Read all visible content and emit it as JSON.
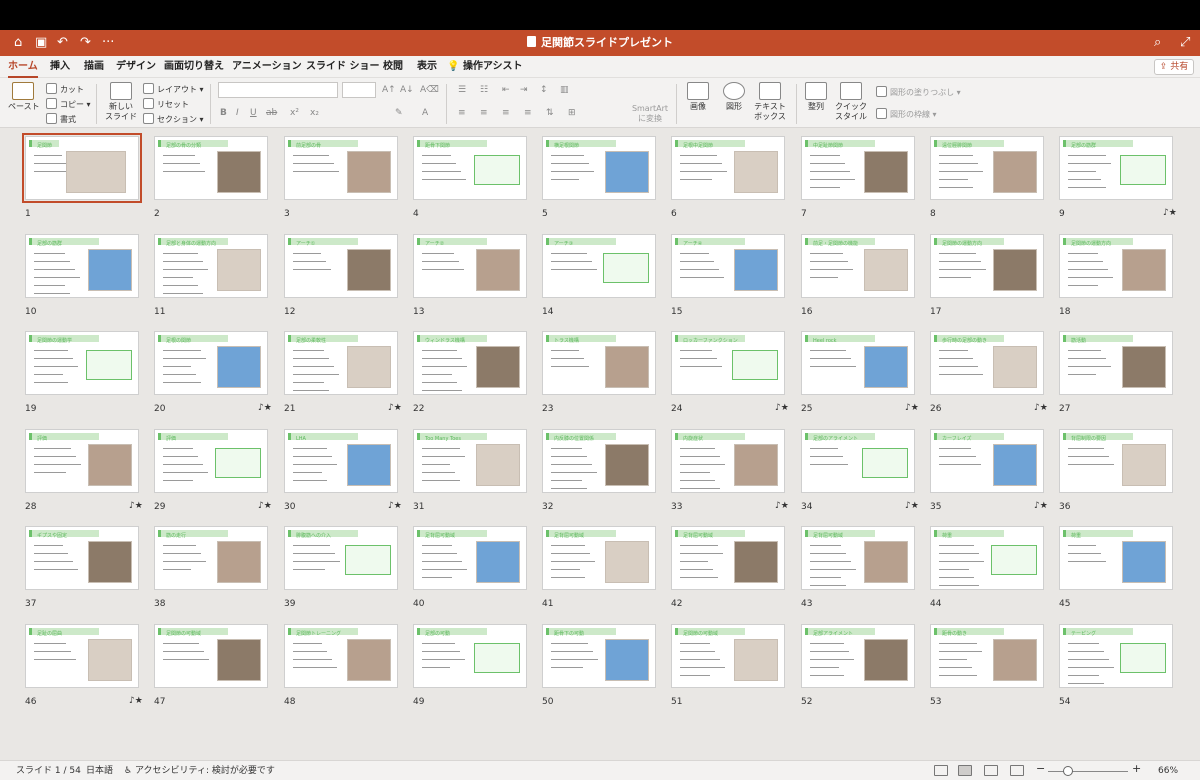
{
  "window": {
    "title": "足関節スライドプレゼント"
  },
  "quick_access": {
    "home": "⌂",
    "save": "▣",
    "undo": "↶",
    "redo": "↷",
    "more": "···",
    "search": "⌕",
    "fullscreen": "⤢"
  },
  "tabs": [
    "ホーム",
    "挿入",
    "描画",
    "デザイン",
    "画面切り替え",
    "アニメーション",
    "スライド ショー",
    "校閲",
    "表示",
    "操作アシスト"
  ],
  "share_label": "共有",
  "ribbon": {
    "paste": "ペースト",
    "cut": "カット",
    "copy": "コピー",
    "format": "書式",
    "new_slide_line1": "新しい",
    "new_slide_line2": "スライド",
    "layout": "レイアウト",
    "reset": "リセット",
    "section": "セクション",
    "smartart_line1": "SmartArt",
    "smartart_line2": "に変換",
    "image": "画像",
    "shape": "図形",
    "textbox_line1": "テキスト",
    "textbox_line2": "ボックス",
    "arrange": "整列",
    "quickstyle_line1": "クイック",
    "quickstyle_line2": "スタイル",
    "shape_fill": "図形の塗りつぶし",
    "shape_outline": "図形の枠線"
  },
  "slides": [
    {
      "n": "1",
      "t": "足関節",
      "star": false
    },
    {
      "n": "2",
      "t": "足部の骨の分類",
      "star": false
    },
    {
      "n": "3",
      "t": "前足部の骨",
      "star": false
    },
    {
      "n": "4",
      "t": "距骨下関節",
      "star": false
    },
    {
      "n": "5",
      "t": "横足根関節",
      "star": false
    },
    {
      "n": "6",
      "t": "足根中足関節",
      "star": false
    },
    {
      "n": "7",
      "t": "中足趾節関節",
      "star": false
    },
    {
      "n": "8",
      "t": "遠位脛腓関節",
      "star": false
    },
    {
      "n": "9",
      "t": "足部の筋群",
      "star": true
    },
    {
      "n": "10",
      "t": "足部の筋群",
      "star": false
    },
    {
      "n": "11",
      "t": "足部と身体の運動方向",
      "star": false
    },
    {
      "n": "12",
      "t": "アーチ①",
      "star": false
    },
    {
      "n": "13",
      "t": "アーチ②",
      "star": false
    },
    {
      "n": "14",
      "t": "アーチ③",
      "star": false
    },
    {
      "n": "15",
      "t": "アーチ④",
      "star": false
    },
    {
      "n": "16",
      "t": "前足・足関節の機能",
      "star": false
    },
    {
      "n": "17",
      "t": "足関節の運動方向",
      "star": false
    },
    {
      "n": "18",
      "t": "足関節の運動方向",
      "star": false
    },
    {
      "n": "19",
      "t": "足関節の運動学",
      "star": false
    },
    {
      "n": "20",
      "t": "足根の関節",
      "star": true
    },
    {
      "n": "21",
      "t": "足部の柔軟性",
      "star": true
    },
    {
      "n": "22",
      "t": "ウィンドラス機構",
      "star": false
    },
    {
      "n": "23",
      "t": "トラス機構",
      "star": false
    },
    {
      "n": "24",
      "t": "ロッカーファンクション",
      "star": true
    },
    {
      "n": "25",
      "t": "Heel rock",
      "star": true
    },
    {
      "n": "26",
      "t": "歩行時の足部の動き",
      "star": true
    },
    {
      "n": "27",
      "t": "筋活動",
      "star": false
    },
    {
      "n": "28",
      "t": "評価",
      "star": true
    },
    {
      "n": "29",
      "t": "評価",
      "star": true
    },
    {
      "n": "30",
      "t": "LHA",
      "star": true
    },
    {
      "n": "31",
      "t": "Too Many Toes",
      "star": false
    },
    {
      "n": "32",
      "t": "内反膝の位置関係",
      "star": false
    },
    {
      "n": "33",
      "t": "内旋症状",
      "star": true
    },
    {
      "n": "34",
      "t": "足部のアライメント",
      "star": true
    },
    {
      "n": "35",
      "t": "カーフレイズ",
      "star": true
    },
    {
      "n": "36",
      "t": "背屈制限の要因",
      "star": false
    },
    {
      "n": "37",
      "t": "ギプスや固定",
      "star": false
    },
    {
      "n": "38",
      "t": "筋の走行",
      "star": false
    },
    {
      "n": "39",
      "t": "腓腹筋への介入",
      "star": false
    },
    {
      "n": "40",
      "t": "足背屈可動域",
      "star": false
    },
    {
      "n": "41",
      "t": "足背屈可動域",
      "star": false
    },
    {
      "n": "42",
      "t": "足背屈可動域",
      "star": false
    },
    {
      "n": "43",
      "t": "足背屈可動域",
      "star": false
    },
    {
      "n": "44",
      "t": "荷重",
      "star": false
    },
    {
      "n": "45",
      "t": "荷重",
      "star": false
    },
    {
      "n": "46",
      "t": "足趾の屈曲",
      "star": true
    },
    {
      "n": "47",
      "t": "足関節の可動域",
      "star": false
    },
    {
      "n": "48",
      "t": "足関節トレーニング",
      "star": false
    },
    {
      "n": "49",
      "t": "足部の可動",
      "star": false
    },
    {
      "n": "50",
      "t": "距骨下の可動",
      "star": false
    },
    {
      "n": "51",
      "t": "足関節の可動域",
      "star": false
    },
    {
      "n": "52",
      "t": "足部アライメント",
      "star": false
    },
    {
      "n": "53",
      "t": "距骨の動き",
      "star": false
    },
    {
      "n": "54",
      "t": "テーピング",
      "star": false
    }
  ],
  "status": {
    "slide_info": "スライド 1 / 54",
    "language": "日本語",
    "accessibility": "アクセシビリティ: 検討が必要です",
    "zoom": "66%"
  }
}
